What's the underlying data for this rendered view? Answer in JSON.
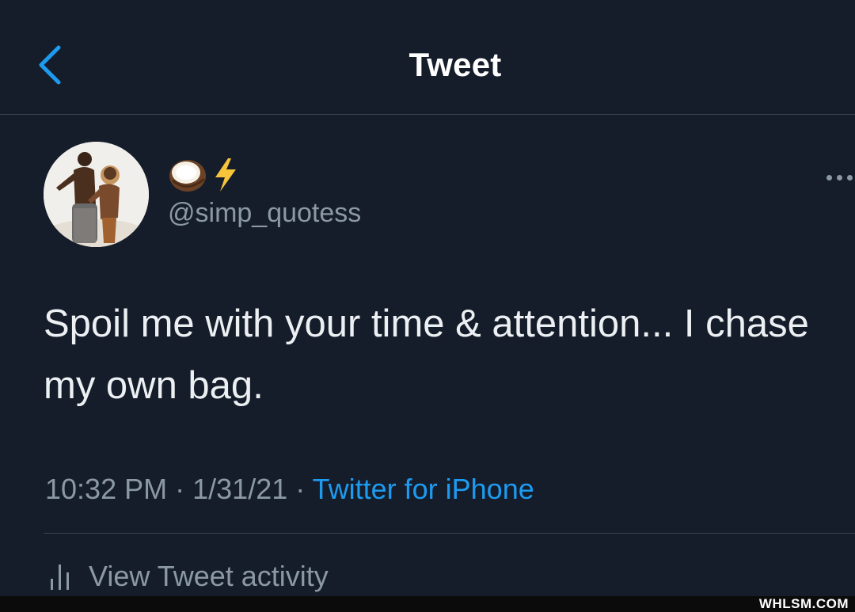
{
  "header": {
    "title": "Tweet",
    "back_icon": "chevron-left-icon"
  },
  "author": {
    "display_name_icons": [
      "coconut-icon",
      "lightning-bolt-icon"
    ],
    "handle": "@simp_quotess",
    "avatar": "profile-photo"
  },
  "tweet": {
    "text": "Spoil me with your time & attention... I chase my own bag.",
    "time": "10:32 PM",
    "date": "1/31/21",
    "separator": "·",
    "source": "Twitter for iPhone"
  },
  "actions": {
    "more_icon": "more-horizontal-icon",
    "activity_label": "View Tweet activity",
    "activity_icon": "bar-chart-icon"
  },
  "watermark": "WHLSM.COM",
  "colors": {
    "background": "#161d2a",
    "accent": "#1d9bf0",
    "secondary_text": "#8b98a5",
    "divider": "#3b4350"
  }
}
